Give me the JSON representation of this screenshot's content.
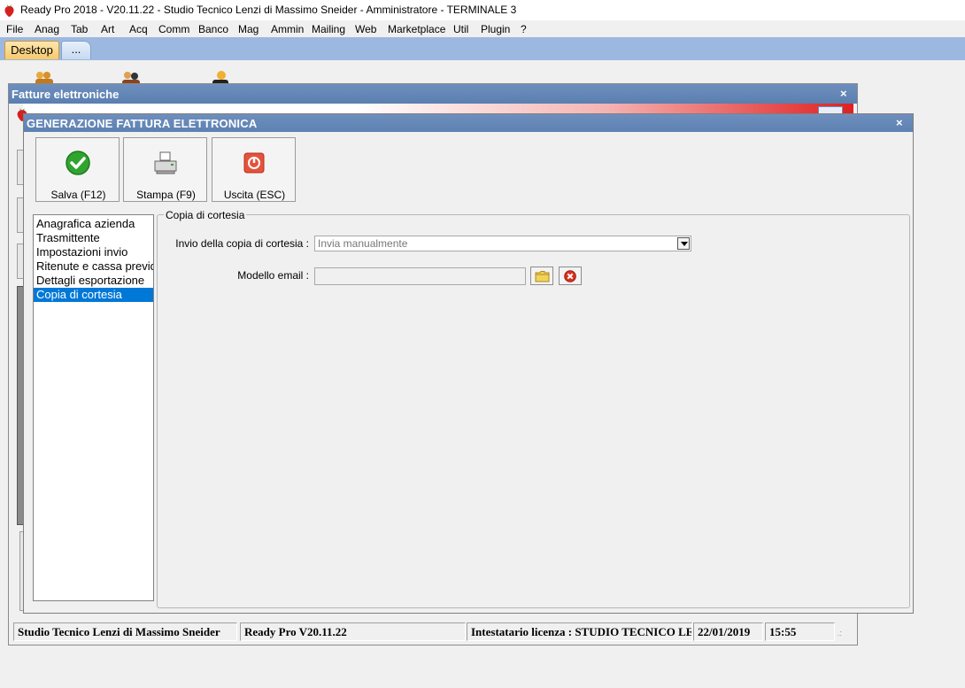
{
  "window": {
    "title": "Ready Pro 2018 - V20.11.22 - Studio Tecnico Lenzi di Massimo Sneider - Amministratore - TERMINALE 3"
  },
  "menu": [
    "File",
    "Anag",
    "Tab",
    "Art",
    "Acq",
    "Comm",
    "Banco",
    "Mag",
    "Ammin",
    "Mailing",
    "Web",
    "Marketplace",
    "Util",
    "Plugin",
    "?"
  ],
  "tabs": {
    "desktop": "Desktop",
    "more": "..."
  },
  "back_window": {
    "title": "Fatture elettroniche",
    "close": "×"
  },
  "dialog": {
    "title": "GENERAZIONE FATTURA ELETTRONICA",
    "close": "×",
    "toolbar": {
      "save": "Salva (F12)",
      "print": "Stampa (F9)",
      "exit": "Uscita (ESC)"
    },
    "nav": [
      "Anagrafica azienda",
      "Trasmittente",
      "Impostazioni invio",
      "Ritenute e cassa previdenziale",
      "Dettagli esportazione",
      "Copia di cortesia"
    ],
    "selected_nav_index": 5,
    "group_title": "Copia di cortesia",
    "fields": {
      "invio_label": "Invio della copia di cortesia :",
      "invio_value": "Invia manualmente",
      "modello_label": "Modello email :",
      "modello_value": ""
    }
  },
  "statusbar": {
    "company": "Studio Tecnico Lenzi di Massimo Sneider",
    "version": "Ready Pro V20.11.22",
    "license": "Intestatario licenza : STUDIO TECNICO LENZI",
    "date": "22/01/2019",
    "time": "15:55"
  },
  "colors": {
    "caption": "#5d81b2",
    "tabstrip": "#9db8e0",
    "selection": "#0078d7",
    "accent_red": "#e02020"
  }
}
